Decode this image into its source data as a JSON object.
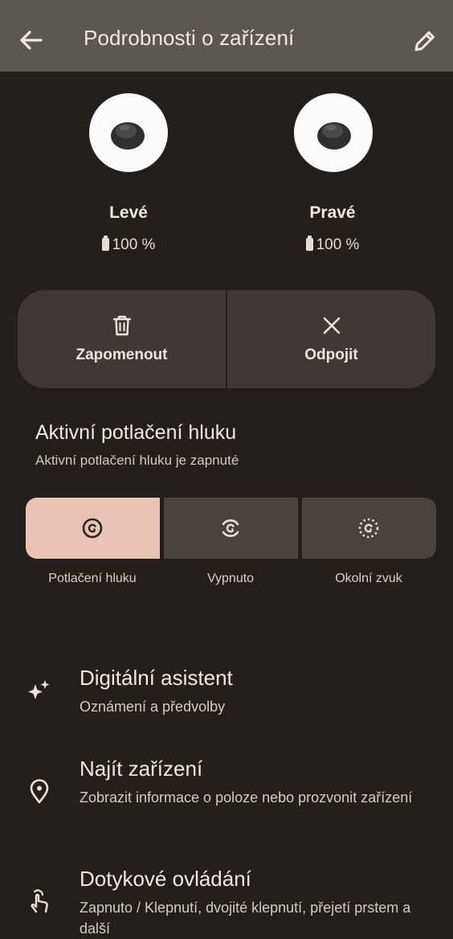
{
  "header": {
    "title": "Podrobnosti o zařízení",
    "back_icon": "arrow-back-icon",
    "edit_icon": "pencil-edit-icon"
  },
  "earbuds": {
    "left": {
      "name": "Levé",
      "battery": "100 %",
      "battery_level": 100
    },
    "right": {
      "name": "Pravé",
      "battery": "100 %",
      "battery_level": 100
    }
  },
  "actions": {
    "forget_label": "Zapomenout",
    "forget_icon": "trash-icon",
    "disconnect_label": "Odpojit",
    "disconnect_icon": "close-icon"
  },
  "anc": {
    "title": "Aktivní potlačení hluku",
    "subtitle": "Aktivní potlačení hluku je zapnuté",
    "options": [
      {
        "label": "Potlačení hluku",
        "icon": "noise-cancellation-icon",
        "selected": true
      },
      {
        "label": "Vypnuto",
        "icon": "anc-off-icon",
        "selected": false
      },
      {
        "label": "Okolní zvuk",
        "icon": "ambient-sound-icon",
        "selected": false
      }
    ]
  },
  "settings": [
    {
      "title": "Digitální asistent",
      "subtitle": "Oznámení a předvolby",
      "icon": "sparkle-icon"
    },
    {
      "title": "Najít zařízení",
      "subtitle": "Zobrazit informace o poloze nebo prozvonit zařízení",
      "icon": "location-pin-icon"
    },
    {
      "title": "Dotykové ovládání",
      "subtitle": "Zapnuto / Klepnutí, dvojité klepnutí, přejetí prstem a další",
      "icon": "touch-gesture-icon"
    }
  ],
  "colors": {
    "background": "#231f1d",
    "app_bar": "#5b5753",
    "card": "#3e3936",
    "segment": "#48433f",
    "segment_selected": "#e9c4b4"
  }
}
